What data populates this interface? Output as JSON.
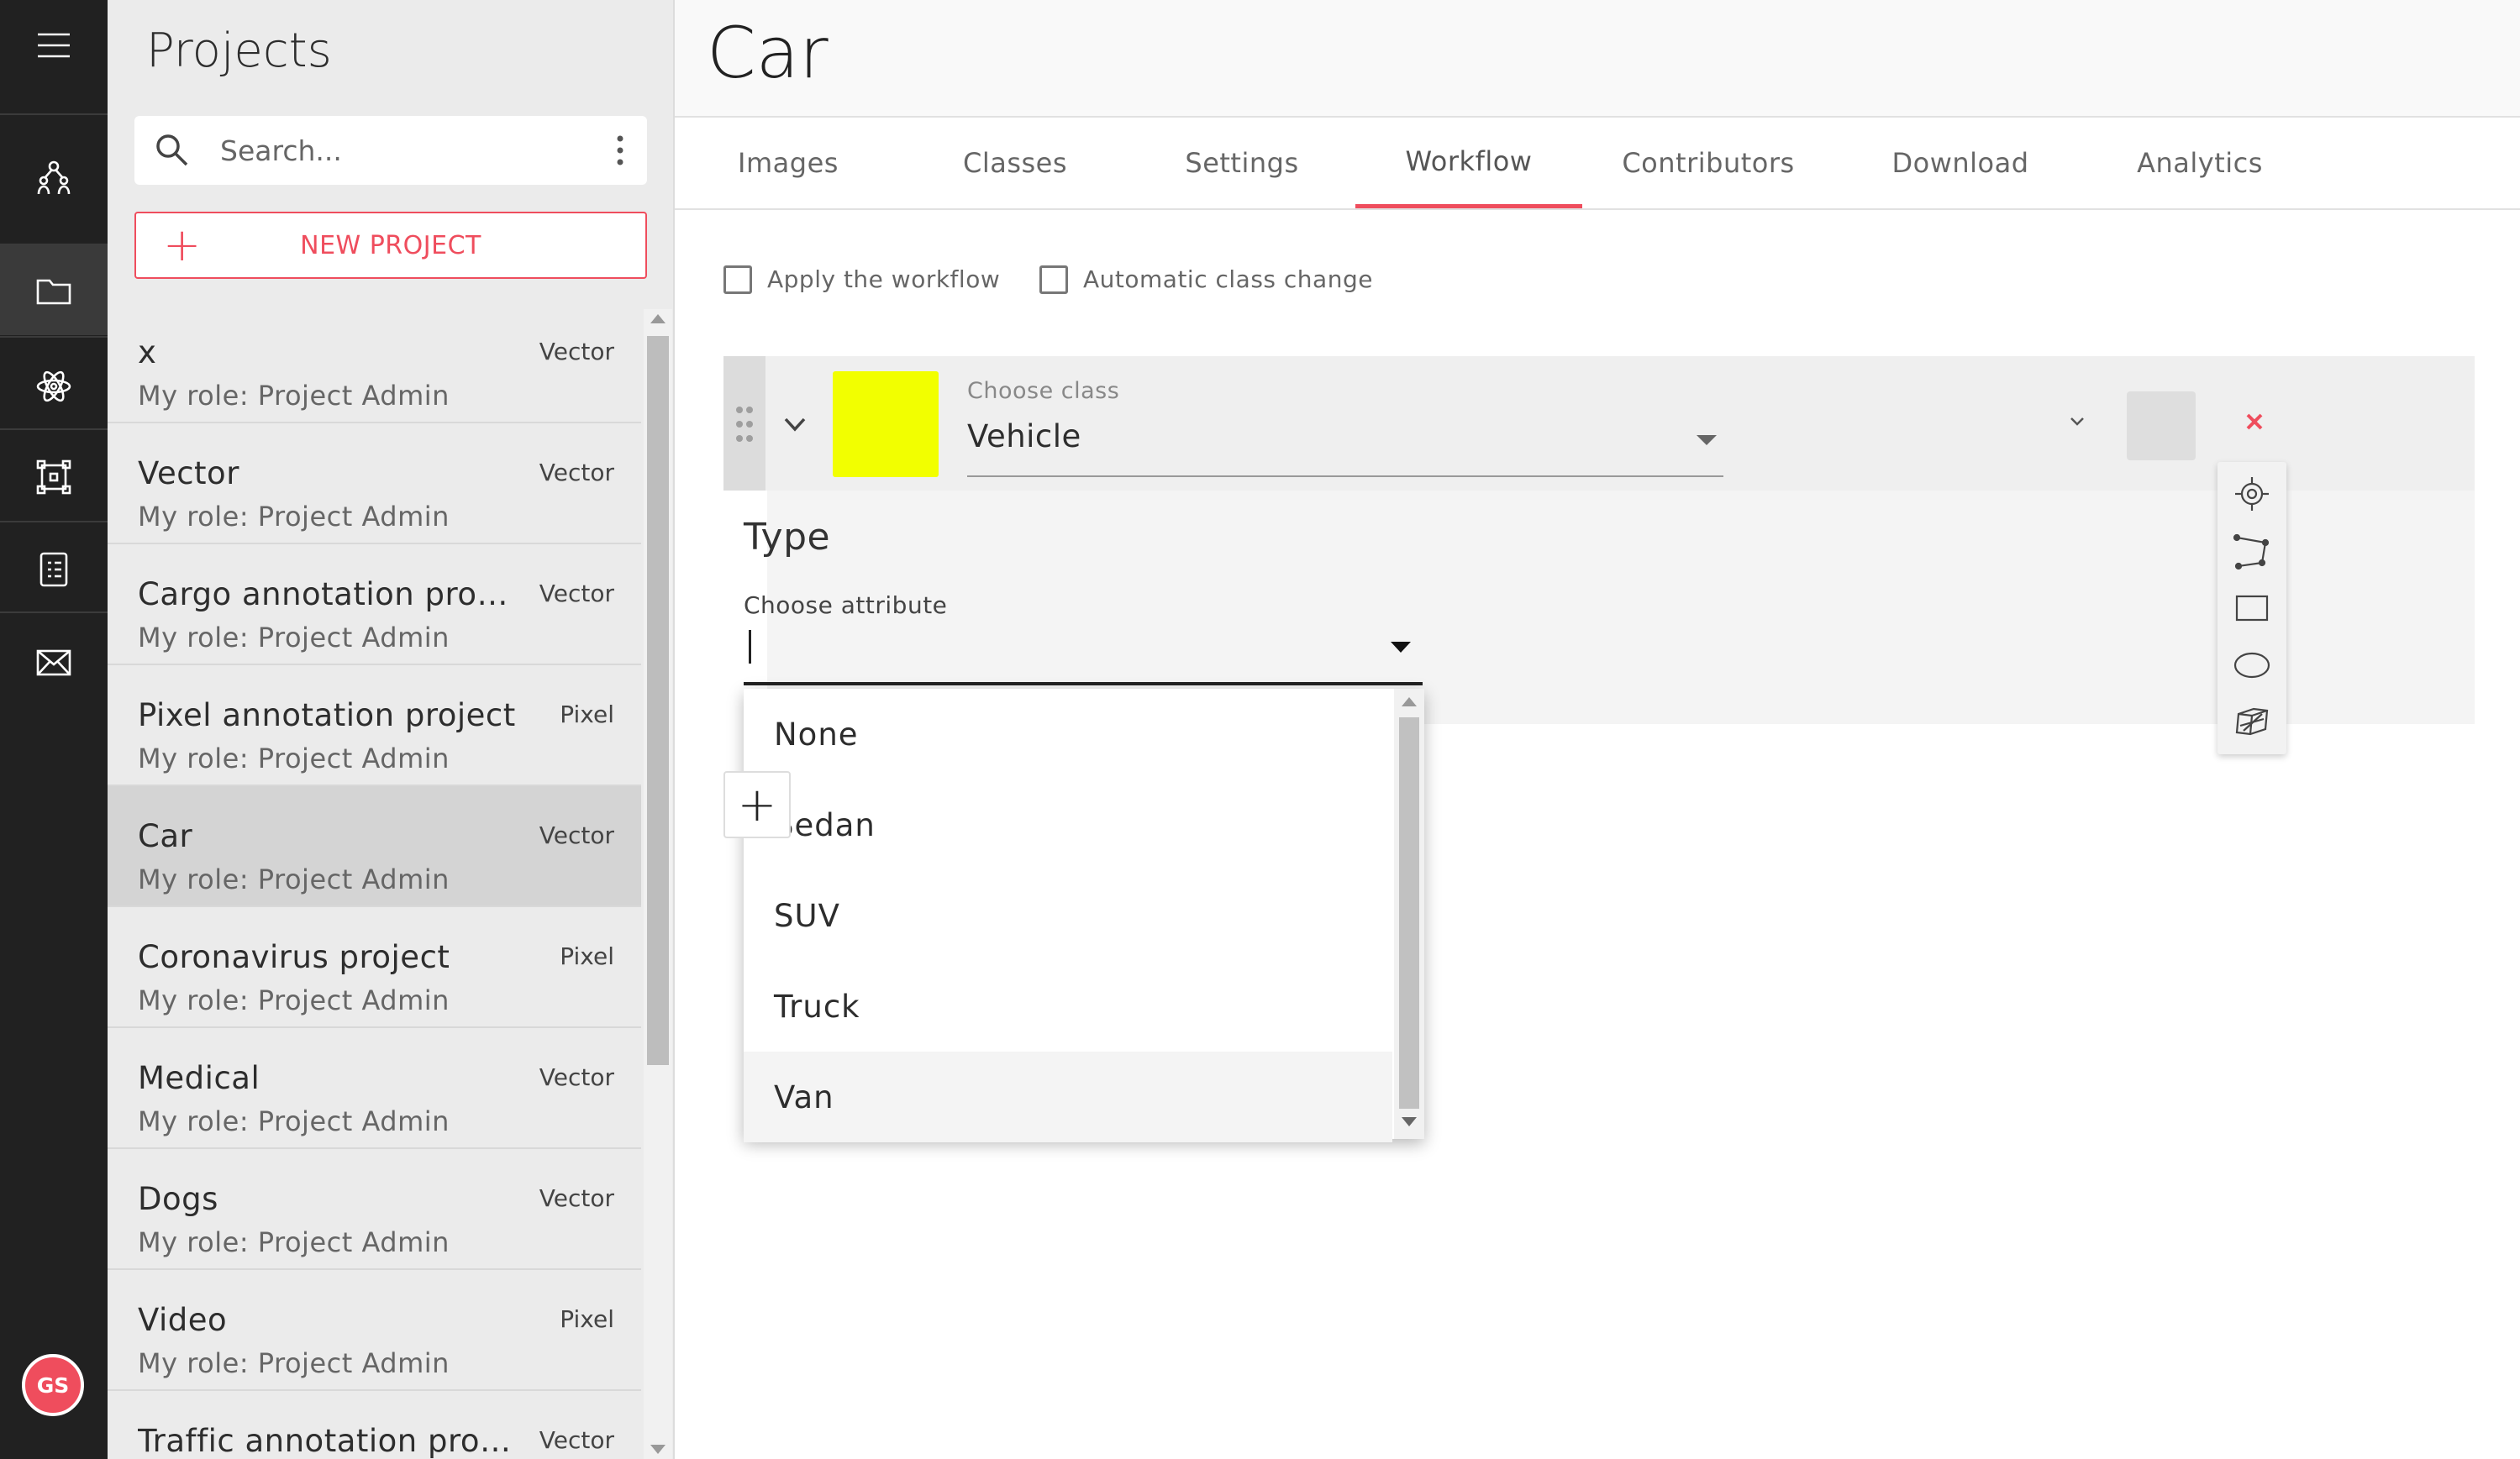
{
  "rail": {
    "items": [
      {
        "icon": "menu-icon"
      },
      {
        "icon": "users-network-icon"
      },
      {
        "icon": "folder-icon",
        "active": true
      },
      {
        "icon": "atom-icon"
      },
      {
        "icon": "bounding-box-icon"
      },
      {
        "icon": "checklist-document-icon"
      },
      {
        "icon": "envelope-icon"
      }
    ],
    "avatar_initials": "GS"
  },
  "projects_panel": {
    "title": "Projects",
    "search_placeholder": "Search...",
    "new_project_label": "NEW PROJECT",
    "projects": [
      {
        "name": "x",
        "type": "Vector",
        "role": "My role: Project Admin"
      },
      {
        "name": "Vector",
        "type": "Vector",
        "role": "My role: Project Admin"
      },
      {
        "name": "Cargo annotation proj...",
        "type": "Vector",
        "role": "My role: Project Admin"
      },
      {
        "name": "Pixel annotation project",
        "type": "Pixel",
        "role": "My role: Project Admin"
      },
      {
        "name": "Car",
        "type": "Vector",
        "role": "My role: Project Admin",
        "selected": true
      },
      {
        "name": "Coronavirus project",
        "type": "Pixel",
        "role": "My role: Project Admin"
      },
      {
        "name": "Medical",
        "type": "Vector",
        "role": "My role: Project Admin"
      },
      {
        "name": "Dogs",
        "type": "Vector",
        "role": "My role: Project Admin"
      },
      {
        "name": "Video",
        "type": "Pixel",
        "role": "My role: Project Admin"
      },
      {
        "name": "Traffic annotation proj...",
        "type": "Vector",
        "role": ""
      }
    ]
  },
  "main": {
    "title": "Car",
    "tabs": [
      {
        "label": "Images"
      },
      {
        "label": "Classes"
      },
      {
        "label": "Settings"
      },
      {
        "label": "Workflow",
        "active": true
      },
      {
        "label": "Contributors"
      },
      {
        "label": "Download"
      },
      {
        "label": "Analytics"
      }
    ],
    "options": {
      "apply_workflow": "Apply the workflow",
      "auto_class_change": "Automatic class change"
    },
    "workflow_step": {
      "class_color": "#f2ff00",
      "choose_class_label": "Choose class",
      "class_value": "Vehicle",
      "type_title": "Type",
      "choose_attribute_label": "Choose attribute",
      "attribute_value": "",
      "attribute_options": [
        "None",
        "Sedan",
        "SUV",
        "Truck",
        "Van"
      ],
      "hovered_option": "Van"
    },
    "add_label": "+",
    "shape_tools": [
      "point-icon",
      "polyline-icon",
      "rectangle-icon",
      "ellipse-icon",
      "cuboid-icon"
    ]
  },
  "colors": {
    "accent": "#ef4d5d",
    "rail_bg": "#212121",
    "panel_bg": "#ebebeb"
  }
}
